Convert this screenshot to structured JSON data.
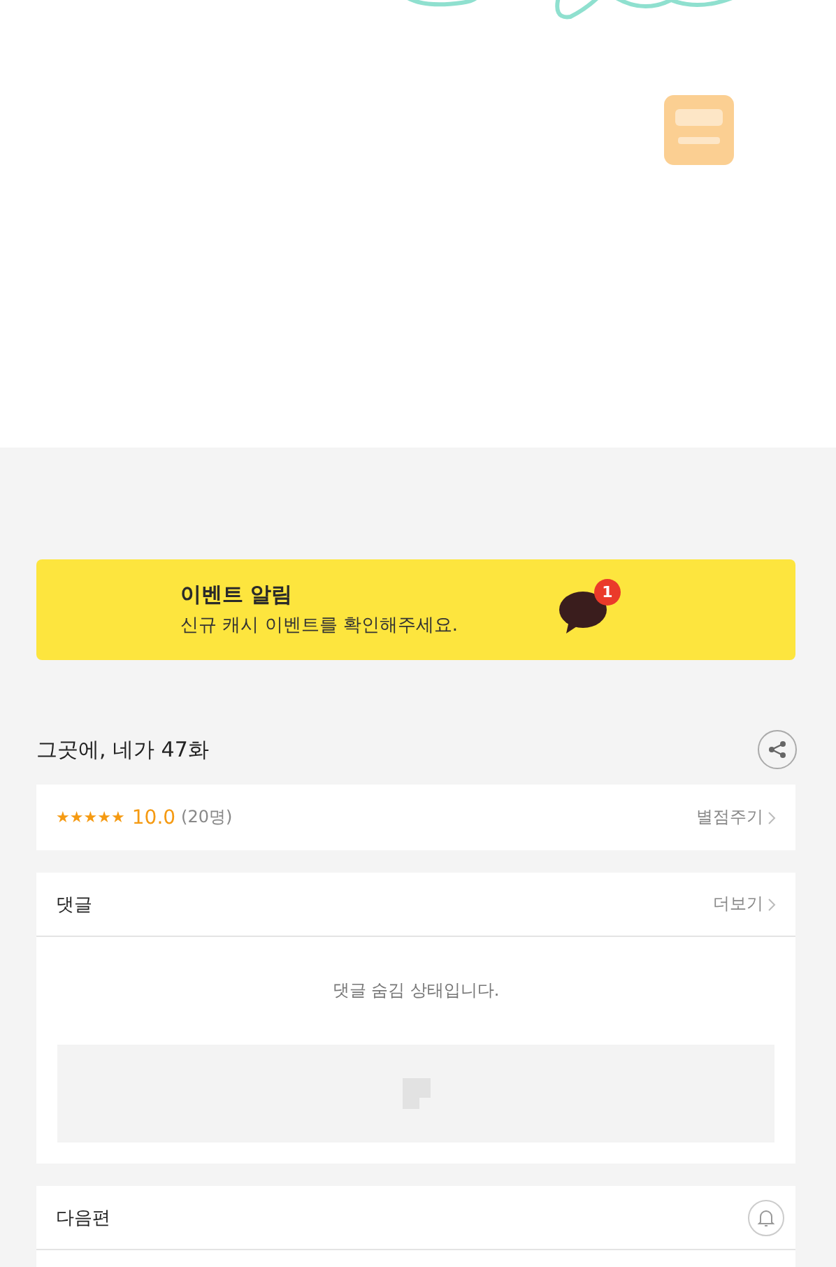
{
  "event_banner": {
    "title": "이벤트 알림",
    "message": "신규 캐시 이벤트를 확인해주세요.",
    "badge": "1"
  },
  "episode": {
    "title": "그곳에, 네가 47화"
  },
  "rating": {
    "stars": 5,
    "score": "10.0",
    "count": "(20명)",
    "action": "별점주기"
  },
  "comments": {
    "title": "댓글",
    "more": "더보기",
    "notice": "댓글 숨김 상태입니다."
  },
  "next": {
    "title": "다음편"
  }
}
